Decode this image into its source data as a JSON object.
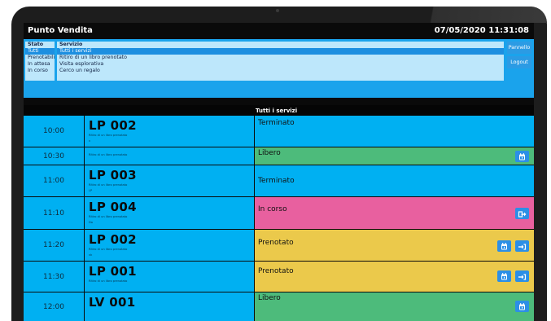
{
  "app": {
    "title": "Punto Vendita",
    "clock": "07/05/2020 11:31:08"
  },
  "filters": {
    "stato": {
      "header": "Stato",
      "items": [
        "Tutti",
        "Prenotabili",
        "In attesa",
        "In corso"
      ],
      "selected": "Tutti"
    },
    "servizio": {
      "header": "Servizio",
      "items": [
        "Tutti i servizi",
        "Ritiro di un libro prenotato",
        "Visita esplorativa",
        "Cerco un regalo"
      ],
      "selected": "Tutti i servizi"
    },
    "buttons": {
      "pannello": "Pannello",
      "logout": "Logout"
    }
  },
  "table": {
    "header": "Tutti i servizi",
    "rows": [
      {
        "time": "10:00",
        "code": "LP 002",
        "service": "Ritiro di un libro prenotato",
        "sub": "v",
        "status": "Terminato",
        "color": "#00b0f2",
        "actions": []
      },
      {
        "time": "10:30",
        "code": "",
        "service": "Ritiro di un libro prenotato",
        "sub": "",
        "status": "Libero",
        "color": "#4dbb7b",
        "actions": [
          "calendar-icon"
        ]
      },
      {
        "time": "11:00",
        "code": "LP 003",
        "service": "Ritiro di un libro prenotato",
        "sub": "LP",
        "status": "Terminato",
        "color": "#00b0f2",
        "actions": []
      },
      {
        "time": "11:10",
        "code": "LP 004",
        "service": "Ritiro di un libro prenotato",
        "sub": "Da",
        "status": "In corso",
        "color": "#e8609f",
        "actions": [
          "exit-icon"
        ]
      },
      {
        "time": "11:20",
        "code": "LP 002",
        "service": "Ritiro di un libro prenotato",
        "sub": "vk",
        "status": "Prenotato",
        "color": "#ebc94b",
        "actions": [
          "calendar-icon",
          "checkin-icon"
        ]
      },
      {
        "time": "11:30",
        "code": "LP 001",
        "service": "Ritiro di un libro prenotato",
        "sub": "",
        "status": "Prenotato",
        "color": "#ebc94b",
        "actions": [
          "calendar-icon",
          "checkin-icon"
        ]
      },
      {
        "time": "12:00",
        "code": "LV 001",
        "service": "",
        "sub": "",
        "status": "Libero",
        "color": "#4dbb7b",
        "actions": [
          "calendar-icon"
        ]
      }
    ]
  }
}
